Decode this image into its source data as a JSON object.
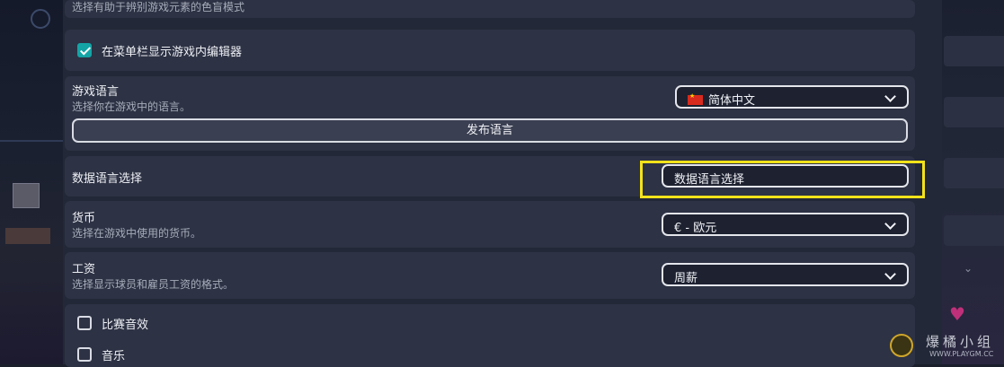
{
  "color_mode": {
    "description": "选择有助于辨别游戏元素的色盲模式"
  },
  "editor_option": {
    "label": "在菜单栏显示游戏内编辑器",
    "checked": true
  },
  "game_language": {
    "title": "游戏语言",
    "description": "选择你在游戏中的语言。",
    "selected": "简体中文",
    "flag": "china-flag-icon",
    "publish_button": "发布语言"
  },
  "data_language": {
    "title": "数据语言选择",
    "button": "数据语言选择",
    "highlight_color": "#f3e21a"
  },
  "currency": {
    "title": "货币",
    "description": "选择在游戏中使用的货币。",
    "selected": "€ - 欧元"
  },
  "wage": {
    "title": "工资",
    "description": "选择显示球员和雇员工资的格式。",
    "selected": "周薪"
  },
  "audio": {
    "match_sound": {
      "label": "比赛音效",
      "checked": false
    },
    "music": {
      "label": "音乐",
      "checked": false
    }
  },
  "watermark": {
    "text": "爆橘小组",
    "url": "WWW.PLAYGM.CC"
  },
  "colors": {
    "accent": "#14a4a6",
    "panel": "#2d3244",
    "background": "#232838"
  }
}
